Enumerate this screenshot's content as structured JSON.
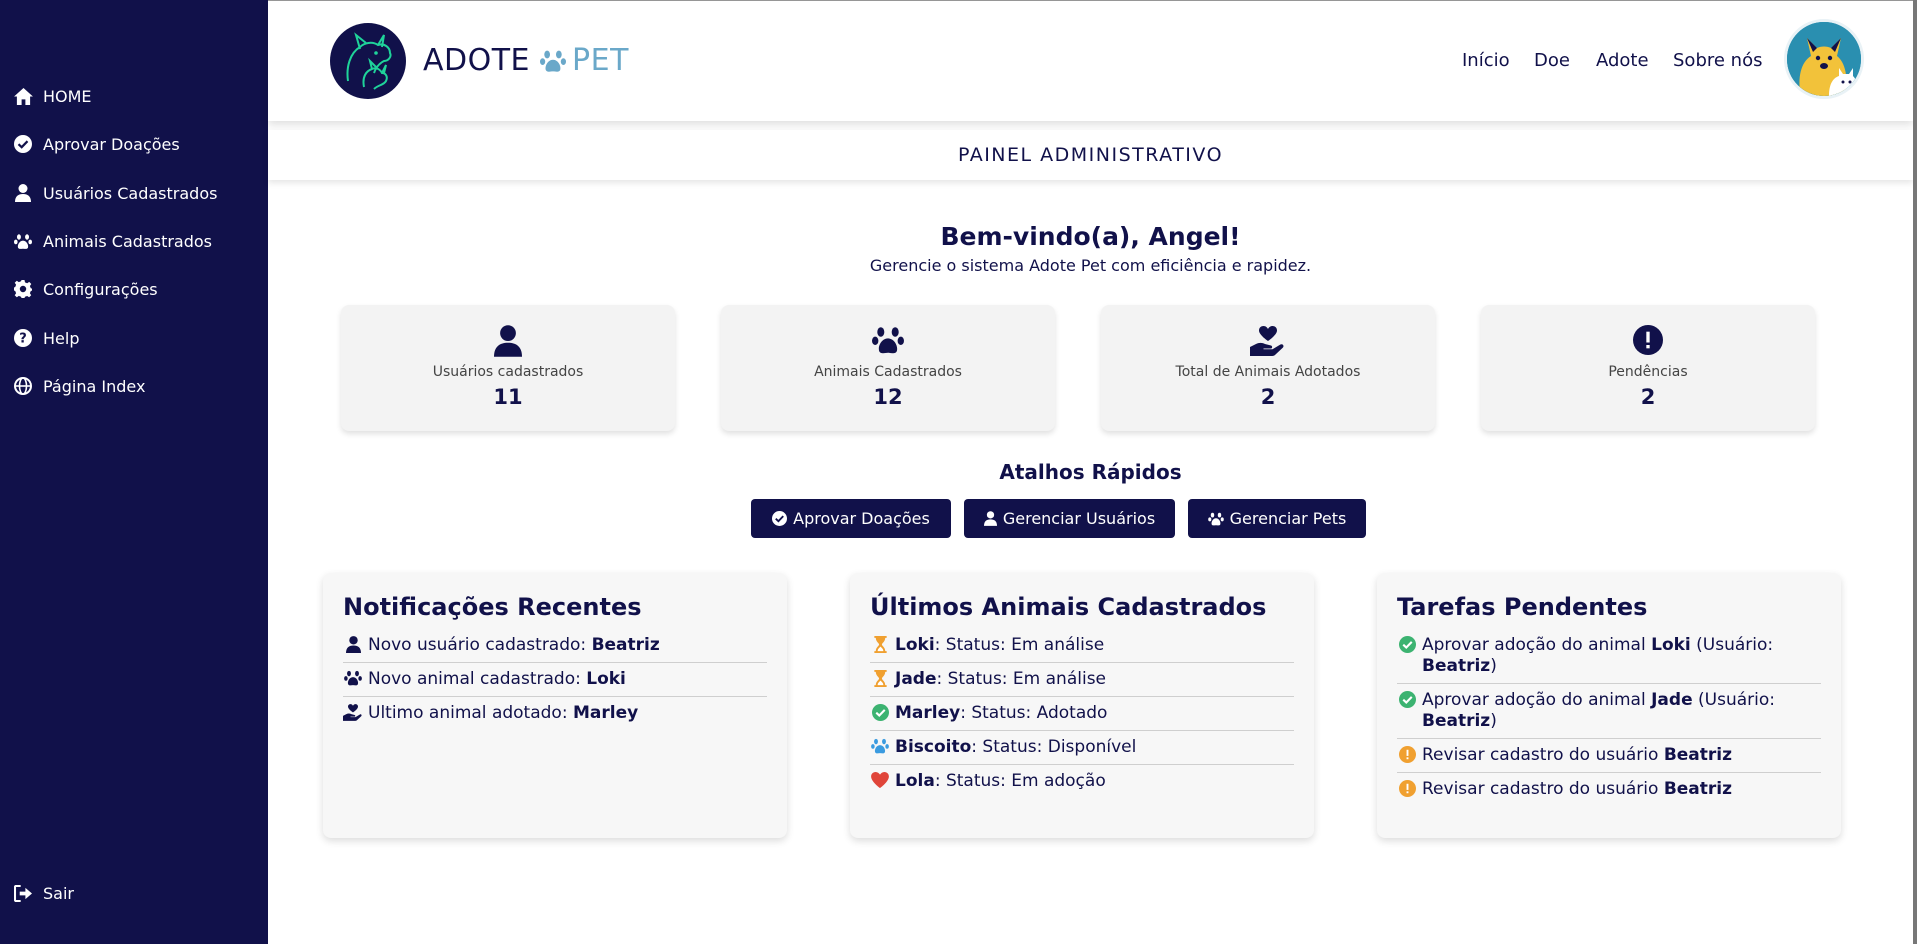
{
  "sidebar": {
    "items": [
      {
        "label": "HOME",
        "icon": "home-icon"
      },
      {
        "label": "Aprovar Doações",
        "icon": "check-circle-icon"
      },
      {
        "label": "Usuários Cadastrados",
        "icon": "user-icon"
      },
      {
        "label": "Animais Cadastrados",
        "icon": "paw-icon"
      },
      {
        "label": "Configurações",
        "icon": "gear-icon"
      },
      {
        "label": "Help",
        "icon": "question-circle-icon"
      },
      {
        "label": "Página Index",
        "icon": "globe-icon"
      }
    ],
    "logout": {
      "label": "Sair",
      "icon": "sign-out-icon"
    }
  },
  "header": {
    "brand_left": "ADOTE",
    "brand_right": "PET",
    "nav": [
      "Início",
      "Doe",
      "Adote",
      "Sobre nós"
    ]
  },
  "subheader": {
    "title": "PAINEL ADMINISTRATIVO"
  },
  "welcome": {
    "title": "Bem-vindo(a), Angel!",
    "subtitle": "Gerencie o sistema Adote Pet com eficiência e rapidez."
  },
  "stats": [
    {
      "label": "Usuários cadastrados",
      "value": "11",
      "icon": "user-icon"
    },
    {
      "label": "Animais Cadastrados",
      "value": "12",
      "icon": "paw-icon"
    },
    {
      "label": "Total de Animais Adotados",
      "value": "2",
      "icon": "hand-heart-icon"
    },
    {
      "label": "Pendências",
      "value": "2",
      "icon": "exclamation-circle-icon"
    }
  ],
  "shortcuts": {
    "title": "Atalhos Rápidos",
    "buttons": [
      {
        "label": "Aprovar Doações",
        "icon": "check-circle-icon"
      },
      {
        "label": "Gerenciar Usuários",
        "icon": "user-icon"
      },
      {
        "label": "Gerenciar Pets",
        "icon": "paw-icon"
      }
    ]
  },
  "notifications": {
    "title": "Notificações Recentes",
    "items": [
      {
        "text": "Novo usuário cadastrado: ",
        "bold": "Beatriz",
        "icon": "user-icon"
      },
      {
        "text": "Novo animal cadastrado: ",
        "bold": "Loki",
        "icon": "paw-icon"
      },
      {
        "text": "Ultimo animal adotado: ",
        "bold": "Marley",
        "icon": "hand-heart-icon"
      }
    ]
  },
  "animals": {
    "title": "Últimos Animais Cadastrados",
    "items": [
      {
        "name": "Loki",
        "status": ": Status: Em análise",
        "icon": "hourglass-icon",
        "color": "#f0a030"
      },
      {
        "name": "Jade",
        "status": ": Status: Em análise",
        "icon": "hourglass-icon",
        "color": "#f0a030"
      },
      {
        "name": "Marley",
        "status": ": Status: Adotado",
        "icon": "check-circle-icon",
        "color": "#3cb371"
      },
      {
        "name": "Biscoito",
        "status": ": Status: Disponível",
        "icon": "paw-icon",
        "color": "#3a9be0"
      },
      {
        "name": "Lola",
        "status": ": Status: Em adoção",
        "icon": "heart-icon",
        "color": "#e0453a"
      }
    ]
  },
  "tasks": {
    "title": "Tarefas Pendentes",
    "items": [
      {
        "prefix": "Aprovar adoção do animal ",
        "animal": "Loki",
        "mid": " (Usuário: ",
        "user": "Beatriz",
        "suffix": ")",
        "icon": "check-circle-icon",
        "color": "#3cb371"
      },
      {
        "prefix": "Aprovar adoção do animal ",
        "animal": "Jade",
        "mid": " (Usuário: ",
        "user": "Beatriz",
        "suffix": ")",
        "icon": "check-circle-icon",
        "color": "#3cb371"
      },
      {
        "prefix": "Revisar cadastro do usuário ",
        "user": "Beatriz",
        "icon": "exclamation-circle-icon",
        "color": "#f0a030"
      },
      {
        "prefix": "Revisar cadastro do usuário ",
        "user": "Beatriz",
        "icon": "exclamation-circle-icon",
        "color": "#f0a030"
      }
    ]
  },
  "colors": {
    "primary": "#11114a",
    "accent": "#6aa8c9",
    "panel": "#f7f7f7"
  }
}
